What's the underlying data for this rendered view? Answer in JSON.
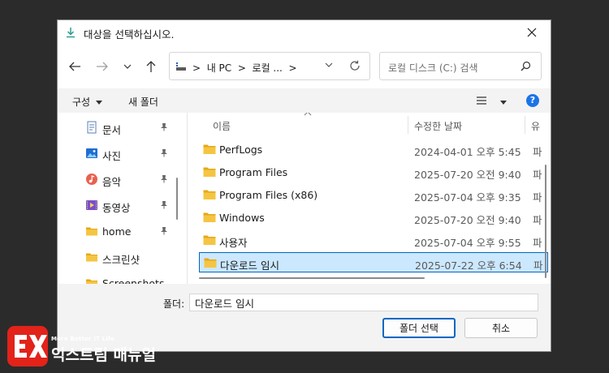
{
  "window": {
    "title": "대상을 선택하십시오."
  },
  "address_bar": {
    "crumbs": [
      "내 PC",
      "로컬 ..."
    ],
    "separator": ">"
  },
  "search": {
    "placeholder": "로컬 디스크 (C:) 검색"
  },
  "toolbar": {
    "organize_label": "구성",
    "new_folder_label": "새 폴더",
    "help_label": "?"
  },
  "sidebar": {
    "items": [
      {
        "label": "문서",
        "icon": "document-icon",
        "pinned": true
      },
      {
        "label": "사진",
        "icon": "picture-icon",
        "pinned": true
      },
      {
        "label": "음악",
        "icon": "music-icon",
        "pinned": true
      },
      {
        "label": "동영상",
        "icon": "video-icon",
        "pinned": true
      },
      {
        "label": "home",
        "icon": "folder-icon",
        "pinned": true
      },
      {
        "label": "스크린샷",
        "icon": "folder-icon",
        "pinned": false
      },
      {
        "label": "Screenshots",
        "icon": "folder-icon",
        "pinned": false
      }
    ]
  },
  "columns": {
    "name": "이름",
    "date": "수정한 날짜",
    "type": "유"
  },
  "files": [
    {
      "name": "PerfLogs",
      "date": "2024-04-01 오후 5:45",
      "type": "파"
    },
    {
      "name": "Program Files",
      "date": "2025-07-20 오전 9:40",
      "type": "파"
    },
    {
      "name": "Program Files (x86)",
      "date": "2025-07-04 오후 9:35",
      "type": "파"
    },
    {
      "name": "Windows",
      "date": "2025-07-20 오전 9:40",
      "type": "파"
    },
    {
      "name": "사용자",
      "date": "2025-07-04 오후 9:55",
      "type": "파"
    },
    {
      "name": "다운로드 임시",
      "date": "2025-07-22 오후 6:54",
      "type": "파",
      "selected": true
    }
  ],
  "footer": {
    "folder_label": "폴더:",
    "folder_value": "다운로드 임시",
    "select_button": "폴더 선택",
    "cancel_button": "취소"
  },
  "brand": {
    "tagline": "More Better IT Life",
    "name": "익스트림 매뉴얼"
  },
  "colors": {
    "accent": "#0067c0",
    "selection": "#cce8ff",
    "folder": "#f5c542",
    "brand_red": "#e2231a"
  }
}
